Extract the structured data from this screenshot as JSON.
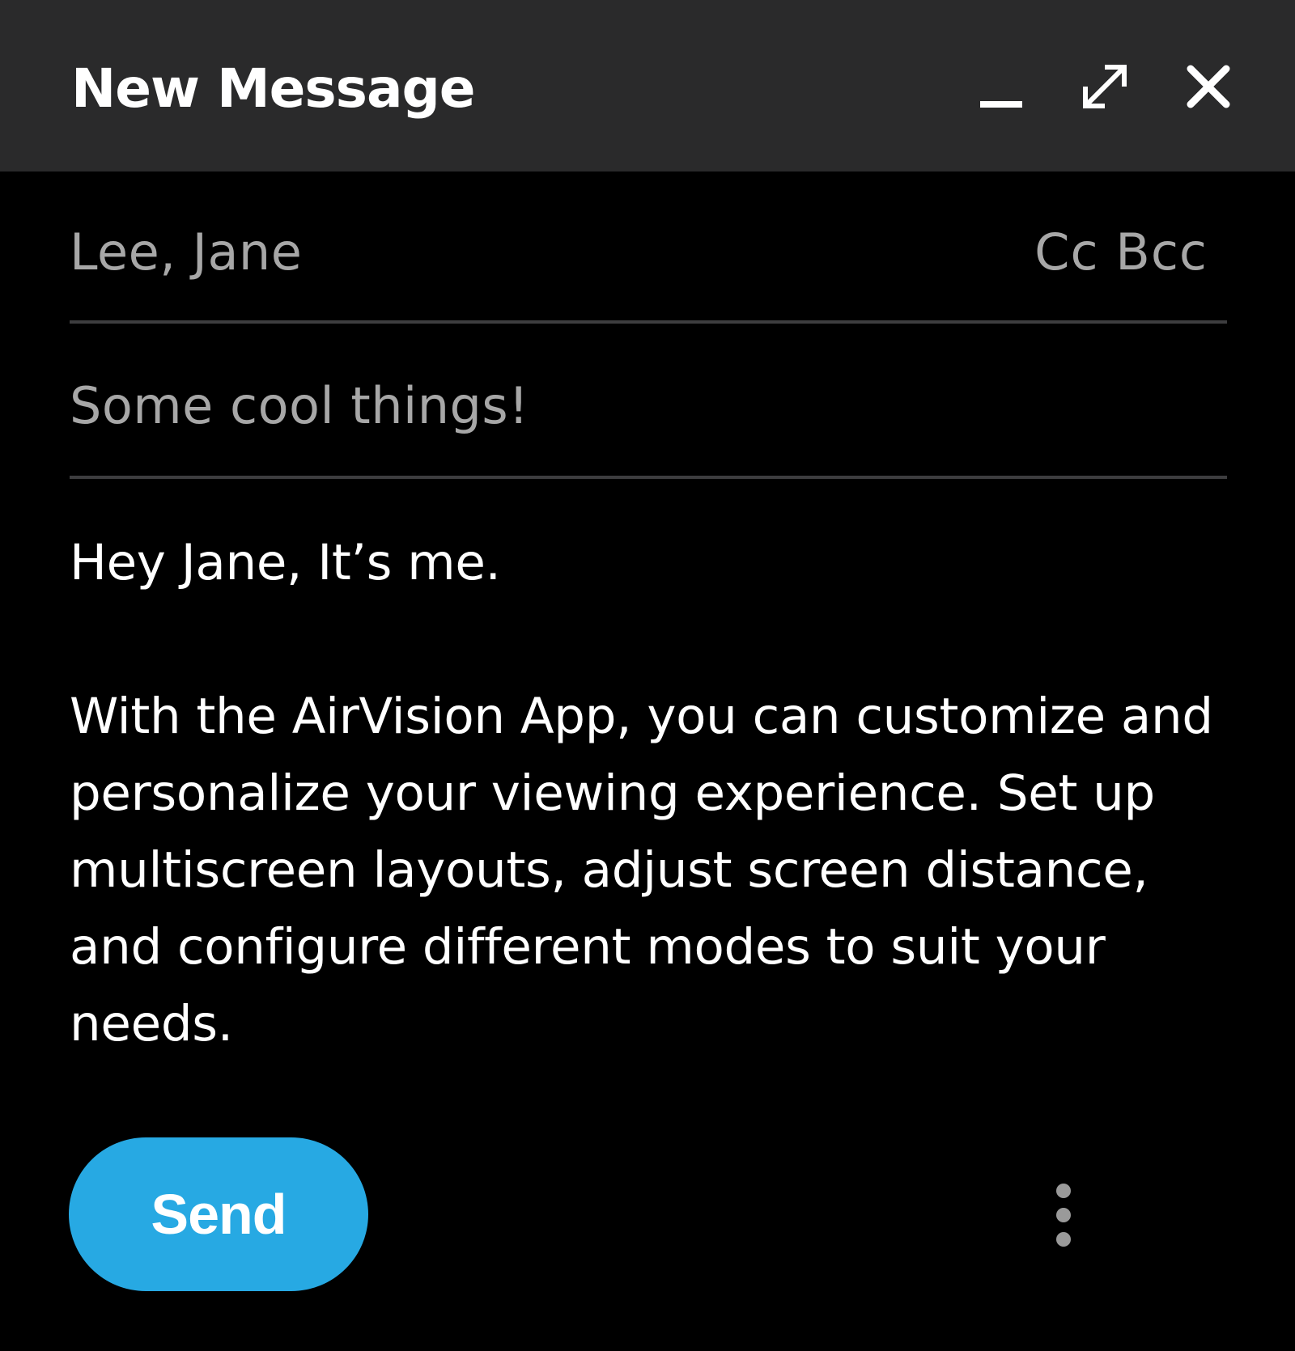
{
  "window": {
    "title": "New Message",
    "background": "#000000",
    "titlebar_color": "#2a2a2b",
    "controls": [
      {
        "name": "minimize",
        "icon": "minimize-icon"
      },
      {
        "name": "expand",
        "icon": "expand-arrows-icon"
      },
      {
        "name": "close",
        "icon": "close-icon"
      }
    ]
  },
  "compose": {
    "to_value": "Lee, Jane",
    "cc_label": "Cc",
    "bcc_label": "Bcc",
    "subject_value": "Some cool things!",
    "body": {
      "greeting": "Hey Jane, It’s me.",
      "paragraph": "With the AirVision App, you can customize and personalize your viewing experience. Set up multiscreen layouts, adjust screen distance, and configure different modes to suit your needs."
    }
  },
  "footer": {
    "send_label": "Send",
    "send_color": "#27a9e3",
    "more_icon": "more-vertical-icon"
  }
}
